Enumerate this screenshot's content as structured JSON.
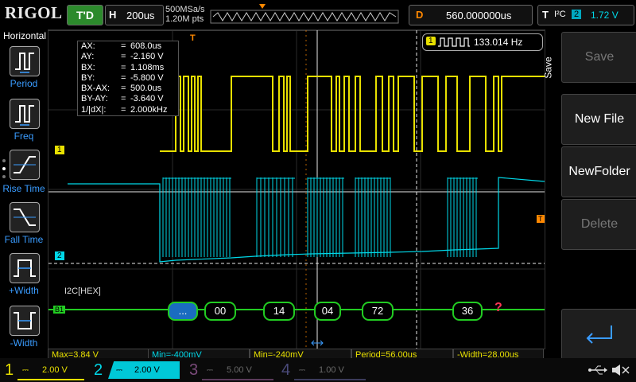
{
  "top": {
    "brand": "RIGOL",
    "run_state": "T'D",
    "horiz_mode": "H",
    "timebase": "200us",
    "sample_rate": "500MSa/s",
    "memory_depth": "1.20M pts",
    "delay_mode": "D",
    "delay_value": "560.000000us",
    "trigger_mode": "T",
    "trigger_type": "I²C",
    "trigger_source": "2",
    "trigger_level": "1.72 V"
  },
  "left": {
    "title": "Horizontal",
    "items": [
      {
        "label": "Period"
      },
      {
        "label": "Freq"
      },
      {
        "label": "Rise Time"
      },
      {
        "label": "Fall Time"
      },
      {
        "label": "+Width"
      },
      {
        "label": "-Width"
      }
    ]
  },
  "cursor_table": {
    "rows": [
      {
        "k": "AX:",
        "v": "608.0us"
      },
      {
        "k": "AY:",
        "v": "-2.160 V"
      },
      {
        "k": "BX:",
        "v": "1.108ms"
      },
      {
        "k": "BY:",
        "v": "-5.800 V"
      },
      {
        "k": "BX-AX:",
        "v": "500.0us"
      },
      {
        "k": "BY-AY:",
        "v": "-3.640 V"
      },
      {
        "k": "1/|dX|:",
        "v": "2.000kHz"
      }
    ]
  },
  "freq_counter": {
    "channel": "1",
    "value": "133.014 Hz"
  },
  "channel_markers": {
    "ch1": "1",
    "ch2": "2",
    "bus": "B1",
    "trigger": "T"
  },
  "bus": {
    "label": "I2C[HEX]",
    "packets": [
      "...",
      "00",
      "14",
      "04",
      "72",
      "36"
    ],
    "error": "?"
  },
  "right": {
    "side_label": "Save",
    "buttons": [
      {
        "label": "Save",
        "enabled": false
      },
      {
        "label": "New File",
        "enabled": true
      },
      {
        "label": "NewFolder",
        "enabled": true
      },
      {
        "label": "Delete",
        "enabled": false
      }
    ],
    "enter_icon": "enter-arrow-icon"
  },
  "measurements": [
    {
      "label": "Max=3.84 V",
      "color": "#e8e000"
    },
    {
      "label": "Min=-400mV",
      "color": "#00d8e8"
    },
    {
      "label": "Min=-240mV",
      "color": "#e8e000"
    },
    {
      "label": "Period=56.00us",
      "color": "#e8e000"
    },
    {
      "label": "-Width=28.00us",
      "color": "#e8e000"
    }
  ],
  "channels": [
    {
      "num": "1",
      "scale": "2.00 V",
      "color": "#e8e000",
      "active": true
    },
    {
      "num": "2",
      "scale": "2.00 V",
      "color": "#00d8e8",
      "active": true
    },
    {
      "num": "3",
      "scale": "5.00 V",
      "color": "#7a4a7a",
      "active": false
    },
    {
      "num": "4",
      "scale": "1.00 V",
      "color": "#4a4a7a",
      "active": false
    }
  ],
  "colors": {
    "ch1": "#e8e000",
    "ch2": "#00d8e8",
    "bus": "#22cc22",
    "accent": "#3a9cff",
    "trigger": "#ff8800"
  }
}
